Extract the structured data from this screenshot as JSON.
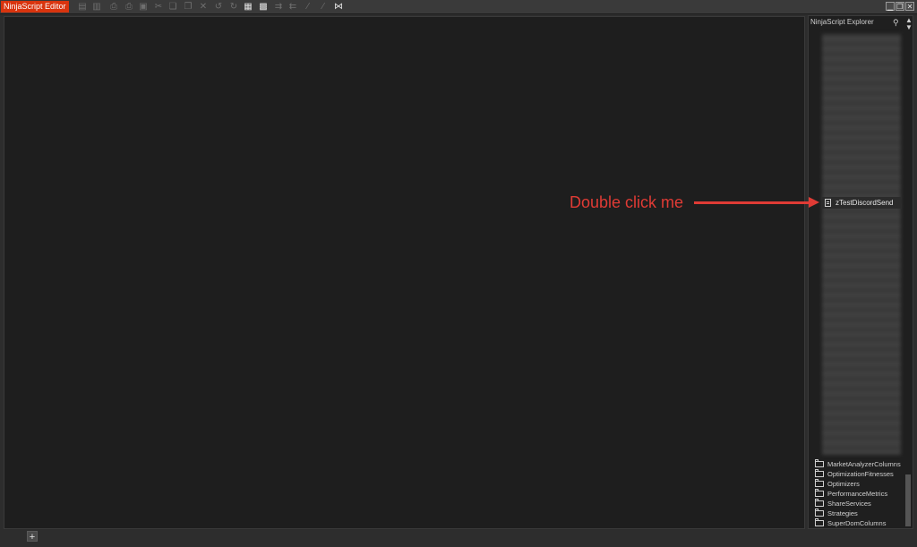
{
  "titlebar": {
    "app_title": "NinjaScript Editor"
  },
  "toolbar": {
    "icons": [
      "save-icon",
      "save-all-icon",
      "print-icon",
      "print-preview-icon",
      "page-setup-icon",
      "cut-icon",
      "copy-icon",
      "paste-icon",
      "delete-icon",
      "undo-icon",
      "redo-icon",
      "find-icon",
      "compile-icon",
      "comment-icon",
      "uncomment-icon",
      "indent-icon",
      "outdent-icon",
      "visual-studio-icon"
    ]
  },
  "window_controls": {
    "minimize": "▁",
    "restore": "❐",
    "close": "✕"
  },
  "explorer": {
    "title": "NinjaScript Explorer",
    "selected_item": "zTestDiscordSend",
    "folders": [
      "MarketAnalyzerColumns",
      "OptimizationFitnesses",
      "Optimizers",
      "PerformanceMetrics",
      "ShareServices",
      "Strategies",
      "SuperDomColumns"
    ]
  },
  "annotation": {
    "text": "Double click me"
  },
  "bottom": {
    "add_tab": "+"
  },
  "colors": {
    "accent": "#d9340e",
    "annotation": "#e03b35",
    "editor_bg": "#1e1e1e"
  }
}
